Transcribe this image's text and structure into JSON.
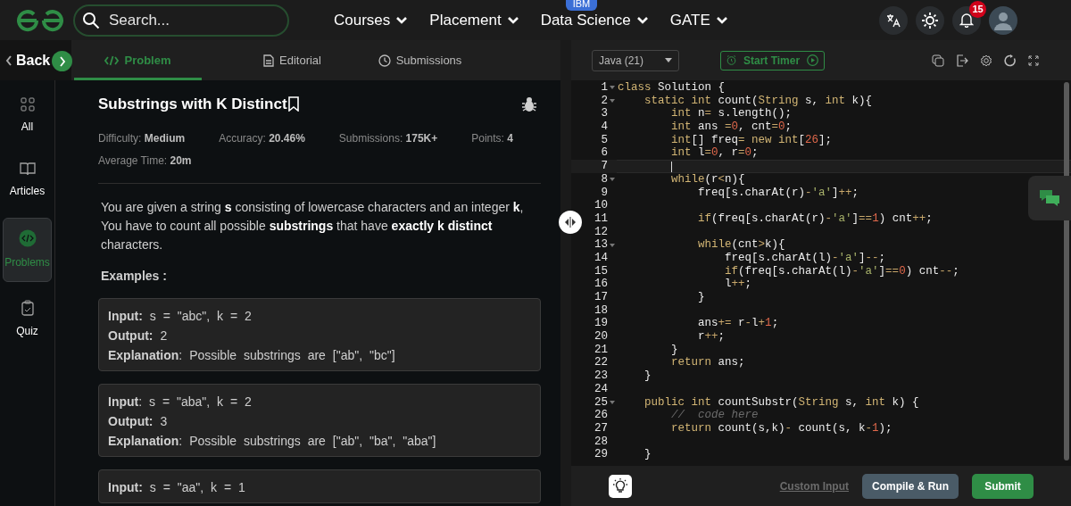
{
  "nav": {
    "search": {
      "placeholder": "Search..."
    },
    "menu": [
      {
        "label": "Courses"
      },
      {
        "label": "Placement"
      },
      {
        "label": "Data Science",
        "badge": "IBM"
      },
      {
        "label": "GATE"
      }
    ],
    "notifications": "15"
  },
  "sidebar": {
    "back": "Back",
    "items": [
      {
        "label": "All",
        "selected": false
      },
      {
        "label": "Articles",
        "selected": false
      },
      {
        "label": "Problems",
        "selected": true
      },
      {
        "label": "Quiz",
        "selected": false
      }
    ]
  },
  "tabs": [
    {
      "label": "Problem",
      "selected": true
    },
    {
      "label": "Editorial",
      "selected": false
    },
    {
      "label": "Submissions",
      "selected": false
    }
  ],
  "problem": {
    "title": "Substrings with K Distinct",
    "meta": [
      "Difficulty: **Medium**",
      "Accuracy: **20.46%**",
      "Submissions: **175K+**",
      "Points: **4**",
      "Average Time: **20m**"
    ],
    "description": "You are given a string **s** consisting of lowercase characters and an integer **k**, You have to count all possible **substrings** that have **exactly k distinct** characters.",
    "examples_heading": "Examples :",
    "examples": [
      [
        "**Input:** s = \"abc\", k = 2",
        "**Output:** 2",
        "**Explanation**: Possible substrings are [\"ab\", \"bc\"]"
      ],
      [
        "**Input**: s = \"aba\", k = 2",
        "**Output:** 3",
        "**Explanation**: Possible substrings are [\"ab\", \"ba\", \"aba\"]"
      ],
      [
        "**Input:** s = \"aa\", k = 1"
      ]
    ]
  },
  "editor": {
    "language": "Java (21)",
    "timer": "Start Timer",
    "lines": [
      {
        "n": "1",
        "fold": true,
        "current": false,
        "tokens": [
          {
            "text": "class ",
            "kind": "kw"
          },
          {
            "text": "Solution {",
            "kind": "id"
          }
        ]
      },
      {
        "n": "2",
        "fold": true,
        "current": false,
        "tokens": [
          {
            "text": "    static int ",
            "kind": "kw"
          },
          {
            "text": "count(",
            "kind": "id"
          },
          {
            "text": "String",
            "kind": "kw"
          },
          {
            "text": " s, ",
            "kind": "id"
          },
          {
            "text": "int",
            "kind": "kw"
          },
          {
            "text": " k){",
            "kind": "id"
          }
        ]
      },
      {
        "n": "3",
        "fold": false,
        "current": false,
        "tokens": [
          {
            "text": "        int ",
            "kind": "kw"
          },
          {
            "text": "n",
            "kind": "id"
          },
          {
            "text": "=",
            "kind": "op"
          },
          {
            "text": " s.length();",
            "kind": "id"
          }
        ]
      },
      {
        "n": "4",
        "fold": false,
        "current": false,
        "tokens": [
          {
            "text": "        int ",
            "kind": "kw"
          },
          {
            "text": "ans ",
            "kind": "id"
          },
          {
            "text": "=",
            "kind": "op"
          },
          {
            "text": "0",
            "kind": "num"
          },
          {
            "text": ", cnt",
            "kind": "id"
          },
          {
            "text": "=",
            "kind": "op"
          },
          {
            "text": "0",
            "kind": "num"
          },
          {
            "text": ";",
            "kind": "id"
          }
        ]
      },
      {
        "n": "5",
        "fold": false,
        "current": false,
        "tokens": [
          {
            "text": "        int",
            "kind": "kw"
          },
          {
            "text": "[] freq",
            "kind": "id"
          },
          {
            "text": "= new int",
            "kind": "kw"
          },
          {
            "text": "[",
            "kind": "id"
          },
          {
            "text": "26",
            "kind": "num"
          },
          {
            "text": "];",
            "kind": "id"
          }
        ]
      },
      {
        "n": "6",
        "fold": false,
        "current": false,
        "tokens": [
          {
            "text": "        int ",
            "kind": "kw"
          },
          {
            "text": "l",
            "kind": "id"
          },
          {
            "text": "=",
            "kind": "op"
          },
          {
            "text": "0",
            "kind": "num"
          },
          {
            "text": ", r",
            "kind": "id"
          },
          {
            "text": "=",
            "kind": "op"
          },
          {
            "text": "0",
            "kind": "num"
          },
          {
            "text": ";",
            "kind": "id"
          }
        ]
      },
      {
        "n": "7",
        "fold": false,
        "current": true
      },
      {
        "n": "8",
        "fold": true,
        "current": false,
        "tokens": [
          {
            "text": "        while",
            "kind": "kw"
          },
          {
            "text": "(r",
            "kind": "id"
          },
          {
            "text": "<",
            "kind": "op"
          },
          {
            "text": "n){",
            "kind": "id"
          }
        ]
      },
      {
        "n": "9",
        "fold": false,
        "current": false,
        "tokens": [
          {
            "text": "            freq[s.charAt(r)",
            "kind": "id"
          },
          {
            "text": "-",
            "kind": "op"
          },
          {
            "text": "'a'",
            "kind": "str"
          },
          {
            "text": "]",
            "kind": "id"
          },
          {
            "text": "++",
            "kind": "op"
          },
          {
            "text": ";",
            "kind": "id"
          }
        ]
      },
      {
        "n": "10",
        "fold": false,
        "current": false
      },
      {
        "n": "11",
        "fold": false,
        "current": false,
        "tokens": [
          {
            "text": "            if",
            "kind": "kw"
          },
          {
            "text": "(freq[s.charAt(r)",
            "kind": "id"
          },
          {
            "text": "-",
            "kind": "op"
          },
          {
            "text": "'a'",
            "kind": "str"
          },
          {
            "text": "]",
            "kind": "id"
          },
          {
            "text": "==",
            "kind": "op"
          },
          {
            "text": "1",
            "kind": "num"
          },
          {
            "text": ") cnt",
            "kind": "id"
          },
          {
            "text": "++",
            "kind": "op"
          },
          {
            "text": ";",
            "kind": "id"
          }
        ]
      },
      {
        "n": "12",
        "fold": false,
        "current": false
      },
      {
        "n": "13",
        "fold": true,
        "current": false,
        "tokens": [
          {
            "text": "            while",
            "kind": "kw"
          },
          {
            "text": "(cnt",
            "kind": "id"
          },
          {
            "text": ">",
            "kind": "op"
          },
          {
            "text": "k){",
            "kind": "id"
          }
        ]
      },
      {
        "n": "14",
        "fold": false,
        "current": false,
        "tokens": [
          {
            "text": "                freq[s.charAt(l)",
            "kind": "id"
          },
          {
            "text": "-",
            "kind": "op"
          },
          {
            "text": "'a'",
            "kind": "str"
          },
          {
            "text": "]",
            "kind": "id"
          },
          {
            "text": "--",
            "kind": "op"
          },
          {
            "text": ";",
            "kind": "id"
          }
        ]
      },
      {
        "n": "15",
        "fold": false,
        "current": false,
        "tokens": [
          {
            "text": "                if",
            "kind": "kw"
          },
          {
            "text": "(freq[s.charAt(l)",
            "kind": "id"
          },
          {
            "text": "-",
            "kind": "op"
          },
          {
            "text": "'a'",
            "kind": "str"
          },
          {
            "text": "]",
            "kind": "id"
          },
          {
            "text": "==",
            "kind": "op"
          },
          {
            "text": "0",
            "kind": "num"
          },
          {
            "text": ") cnt",
            "kind": "id"
          },
          {
            "text": "--",
            "kind": "op"
          },
          {
            "text": ";",
            "kind": "id"
          }
        ]
      },
      {
        "n": "16",
        "fold": false,
        "current": false,
        "tokens": [
          {
            "text": "                l",
            "kind": "id"
          },
          {
            "text": "++",
            "kind": "op"
          },
          {
            "text": ";",
            "kind": "id"
          }
        ]
      },
      {
        "n": "17",
        "fold": false,
        "current": false,
        "tokens": [
          {
            "text": "            }",
            "kind": "id"
          }
        ]
      },
      {
        "n": "18",
        "fold": false,
        "current": false
      },
      {
        "n": "19",
        "fold": false,
        "current": false,
        "tokens": [
          {
            "text": "            ans",
            "kind": "id"
          },
          {
            "text": "+=",
            "kind": "op"
          },
          {
            "text": " r",
            "kind": "id"
          },
          {
            "text": "-",
            "kind": "op"
          },
          {
            "text": "l",
            "kind": "id"
          },
          {
            "text": "+",
            "kind": "op"
          },
          {
            "text": "1",
            "kind": "num"
          },
          {
            "text": ";",
            "kind": "id"
          }
        ]
      },
      {
        "n": "20",
        "fold": false,
        "current": false,
        "tokens": [
          {
            "text": "            r",
            "kind": "id"
          },
          {
            "text": "++",
            "kind": "op"
          },
          {
            "text": ";",
            "kind": "id"
          }
        ]
      },
      {
        "n": "21",
        "fold": false,
        "current": false,
        "tokens": [
          {
            "text": "        }",
            "kind": "id"
          }
        ]
      },
      {
        "n": "22",
        "fold": false,
        "current": false,
        "tokens": [
          {
            "text": "        return ",
            "kind": "kw"
          },
          {
            "text": "ans;",
            "kind": "id"
          }
        ]
      },
      {
        "n": "23",
        "fold": false,
        "current": false,
        "tokens": [
          {
            "text": "    }",
            "kind": "id"
          }
        ]
      },
      {
        "n": "24",
        "fold": false,
        "current": false
      },
      {
        "n": "25",
        "fold": true,
        "current": false,
        "tokens": [
          {
            "text": "    public int ",
            "kind": "kw"
          },
          {
            "text": "countSubstr(",
            "kind": "id"
          },
          {
            "text": "String",
            "kind": "kw"
          },
          {
            "text": " s, ",
            "kind": "id"
          },
          {
            "text": "int",
            "kind": "kw"
          },
          {
            "text": " k) {",
            "kind": "id"
          }
        ]
      },
      {
        "n": "26",
        "fold": false,
        "current": false,
        "tokens": [
          {
            "text": "        //  code here",
            "kind": "cm"
          }
        ]
      },
      {
        "n": "27",
        "fold": false,
        "current": false,
        "tokens": [
          {
            "text": "        return ",
            "kind": "kw"
          },
          {
            "text": "count(s,k)",
            "kind": "id"
          },
          {
            "text": "-",
            "kind": "op"
          },
          {
            "text": " count(s, k",
            "kind": "id"
          },
          {
            "text": "-",
            "kind": "op"
          },
          {
            "text": "1",
            "kind": "num"
          },
          {
            "text": ");",
            "kind": "id"
          }
        ]
      },
      {
        "n": "28",
        "fold": false,
        "current": false
      },
      {
        "n": "29",
        "fold": false,
        "current": false,
        "tokens": [
          {
            "text": "    }",
            "kind": "id"
          }
        ]
      }
    ],
    "custom_input": "Custom Input",
    "compile": "Compile & Run",
    "submit": "Submit"
  }
}
